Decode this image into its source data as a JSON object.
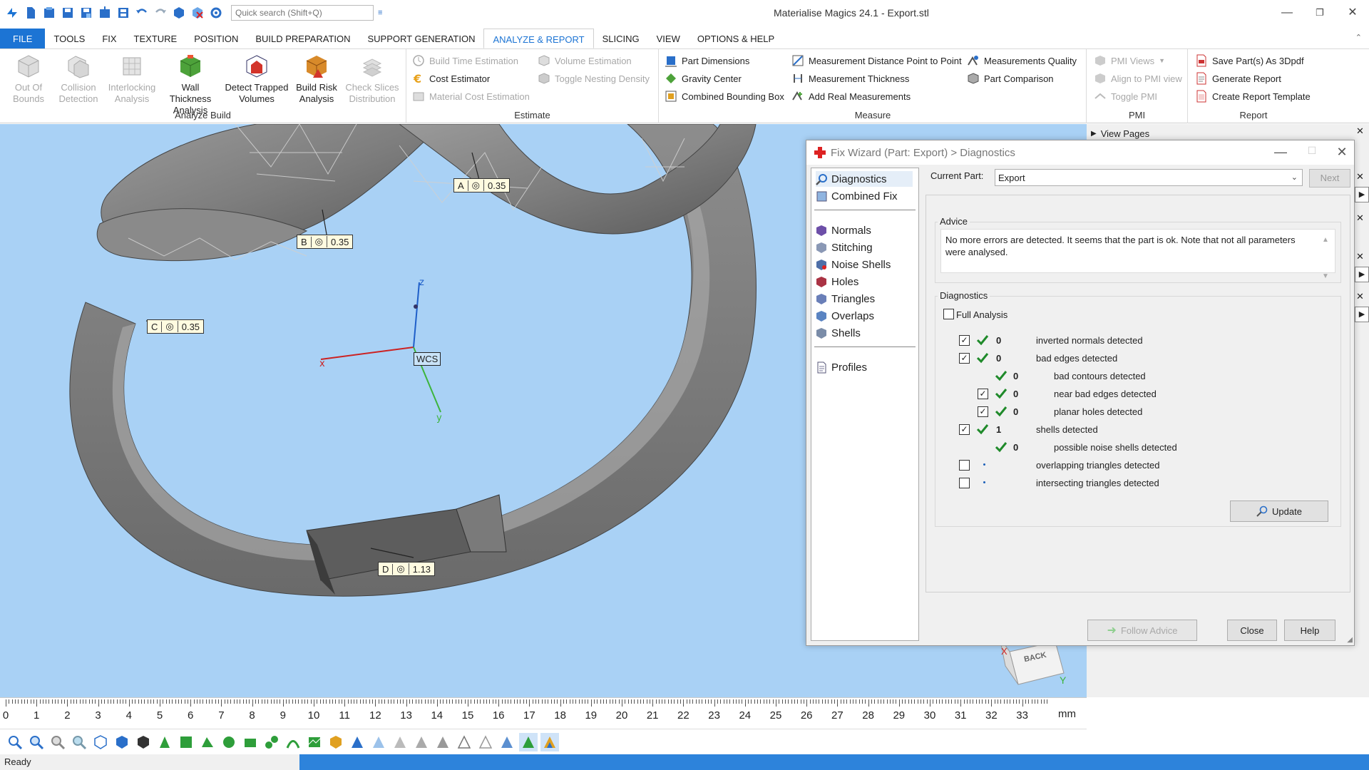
{
  "window": {
    "title": "Materialise Magics 24.1 - Export.stl",
    "search_placeholder": "Quick search (Shift+Q)"
  },
  "tabs": [
    "FILE",
    "TOOLS",
    "FIX",
    "TEXTURE",
    "POSITION",
    "BUILD PREPARATION",
    "SUPPORT GENERATION",
    "ANALYZE & REPORT",
    "SLICING",
    "VIEW",
    "OPTIONS & HELP"
  ],
  "active_tab": "ANALYZE & REPORT",
  "ribbon": {
    "analyze_build": {
      "label": "Analyze Build",
      "buttons": [
        "Out Of Bounds",
        "Collision Detection",
        "Interlocking Analysis",
        "Wall Thickness Analysis",
        "Detect Trapped Volumes",
        "Build Risk Analysis",
        "Check Slices Distribution"
      ]
    },
    "estimate": {
      "label": "Estimate",
      "buttons": [
        "Build Time Estimation",
        "Cost Estimator",
        "Material Cost Estimation",
        "Volume Estimation",
        "Toggle Nesting Density"
      ]
    },
    "measure": {
      "label": "Measure",
      "buttons": [
        "Part Dimensions",
        "Gravity Center",
        "Combined Bounding Box",
        "Measurement Distance Point to Point",
        "Measurement Thickness",
        "Add Real Measurements",
        "Measurements Quality",
        "Part Comparison"
      ]
    },
    "pmi": {
      "label": "PMI",
      "buttons": [
        "PMI Views",
        "Align to PMI view",
        "Toggle PMI"
      ]
    },
    "report": {
      "label": "Report",
      "buttons": [
        "Save Part(s) As 3Dpdf",
        "Generate Report",
        "Create Report Template"
      ]
    }
  },
  "viewport": {
    "annotations": [
      {
        "id": "A",
        "value": "0.35"
      },
      {
        "id": "B",
        "value": "0.35"
      },
      {
        "id": "C",
        "value": "0.35"
      },
      {
        "id": "D",
        "value": "1.13"
      }
    ],
    "wcs": "WCS",
    "axes": {
      "x": "x",
      "y": "y",
      "z": "z"
    },
    "cube_label": "BACK",
    "cube_axis_x": "X",
    "cube_axis_y": "Y",
    "view_pages": "View Pages"
  },
  "ruler": {
    "unit": "mm",
    "labels": [
      "0",
      "1",
      "2",
      "3",
      "4",
      "5",
      "6",
      "7",
      "8",
      "9",
      "10",
      "11",
      "12",
      "13",
      "14",
      "15",
      "16",
      "17",
      "18",
      "19",
      "20",
      "21",
      "22",
      "23",
      "24",
      "25",
      "26",
      "27",
      "28",
      "29",
      "30",
      "31",
      "32",
      "33"
    ]
  },
  "status": "Ready",
  "dialog": {
    "title": "Fix Wizard (Part: Export) > Diagnostics",
    "nav": {
      "top": [
        "Diagnostics",
        "Combined Fix"
      ],
      "middle": [
        "Normals",
        "Stitching",
        "Noise Shells",
        "Holes",
        "Triangles",
        "Overlaps",
        "Shells"
      ],
      "bottom": [
        "Profiles"
      ]
    },
    "current_part_label": "Current Part:",
    "current_part_value": "Export",
    "next": "Next",
    "advice_label": "Advice",
    "advice_text": "No more errors are detected. It seems that the part is ok. Note that not all parameters were analysed.",
    "diagnostics_label": "Diagnostics",
    "full_analysis": "Full Analysis",
    "rows": [
      {
        "value": "0",
        "text": "inverted normals detected"
      },
      {
        "value": "0",
        "text": "bad edges detected"
      },
      {
        "value": "0",
        "text": "bad contours detected"
      },
      {
        "value": "0",
        "text": "near bad edges detected"
      },
      {
        "value": "0",
        "text": "planar holes detected"
      },
      {
        "value": "1",
        "text": "shells detected"
      },
      {
        "value": "0",
        "text": "possible noise shells detected"
      },
      {
        "value": "",
        "text": "overlapping triangles detected"
      },
      {
        "value": "",
        "text": "intersecting triangles detected"
      }
    ],
    "update": "Update",
    "follow_advice": "Follow Advice",
    "close": "Close",
    "help": "Help"
  },
  "colors": {
    "accent": "#1c74d4",
    "viewport_bg": "#a9d1f5",
    "check_green": "#1f8a2a",
    "status_blue": "#2d83db"
  }
}
